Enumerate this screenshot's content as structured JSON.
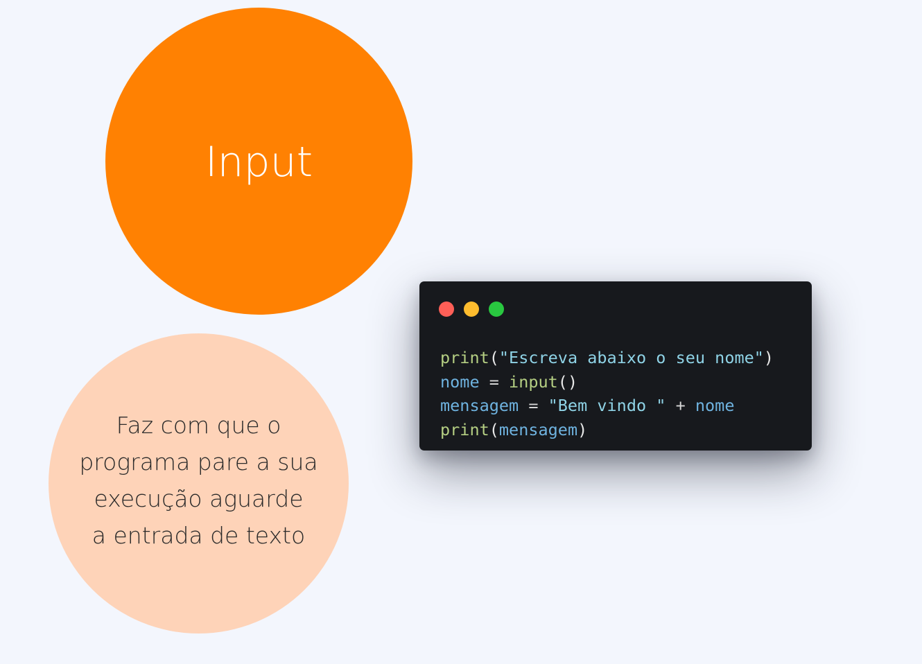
{
  "slide": {
    "title": "Input",
    "description_lines": [
      "Faz com que o",
      "programa pare a sua",
      "execução aguarde",
      "a entrada de texto"
    ],
    "colors": {
      "background": "#f3f6fd",
      "primary_circle": "#ff8102",
      "secondary_circle": "#fed3b8",
      "code_background": "#17191d"
    }
  },
  "code_window": {
    "controls": [
      "close-dot",
      "minimize-dot",
      "maximize-dot"
    ],
    "lines": [
      [
        {
          "t": "print",
          "k": "fn"
        },
        {
          "t": "(",
          "k": "punc"
        },
        {
          "t": "\"Escreva abaixo o seu nome\"",
          "k": "str"
        },
        {
          "t": ")",
          "k": "punc"
        }
      ],
      [
        {
          "t": "nome",
          "k": "var"
        },
        {
          "t": " = ",
          "k": "op"
        },
        {
          "t": "input",
          "k": "fn"
        },
        {
          "t": "()",
          "k": "punc"
        }
      ],
      [
        {
          "t": "mensagem",
          "k": "var"
        },
        {
          "t": " = ",
          "k": "op"
        },
        {
          "t": "\"Bem vindo \"",
          "k": "str"
        },
        {
          "t": " + ",
          "k": "op"
        },
        {
          "t": "nome",
          "k": "var"
        }
      ],
      [
        {
          "t": "print",
          "k": "fn"
        },
        {
          "t": "(",
          "k": "punc"
        },
        {
          "t": "mensagem",
          "k": "var"
        },
        {
          "t": ")",
          "k": "punc"
        }
      ]
    ]
  }
}
